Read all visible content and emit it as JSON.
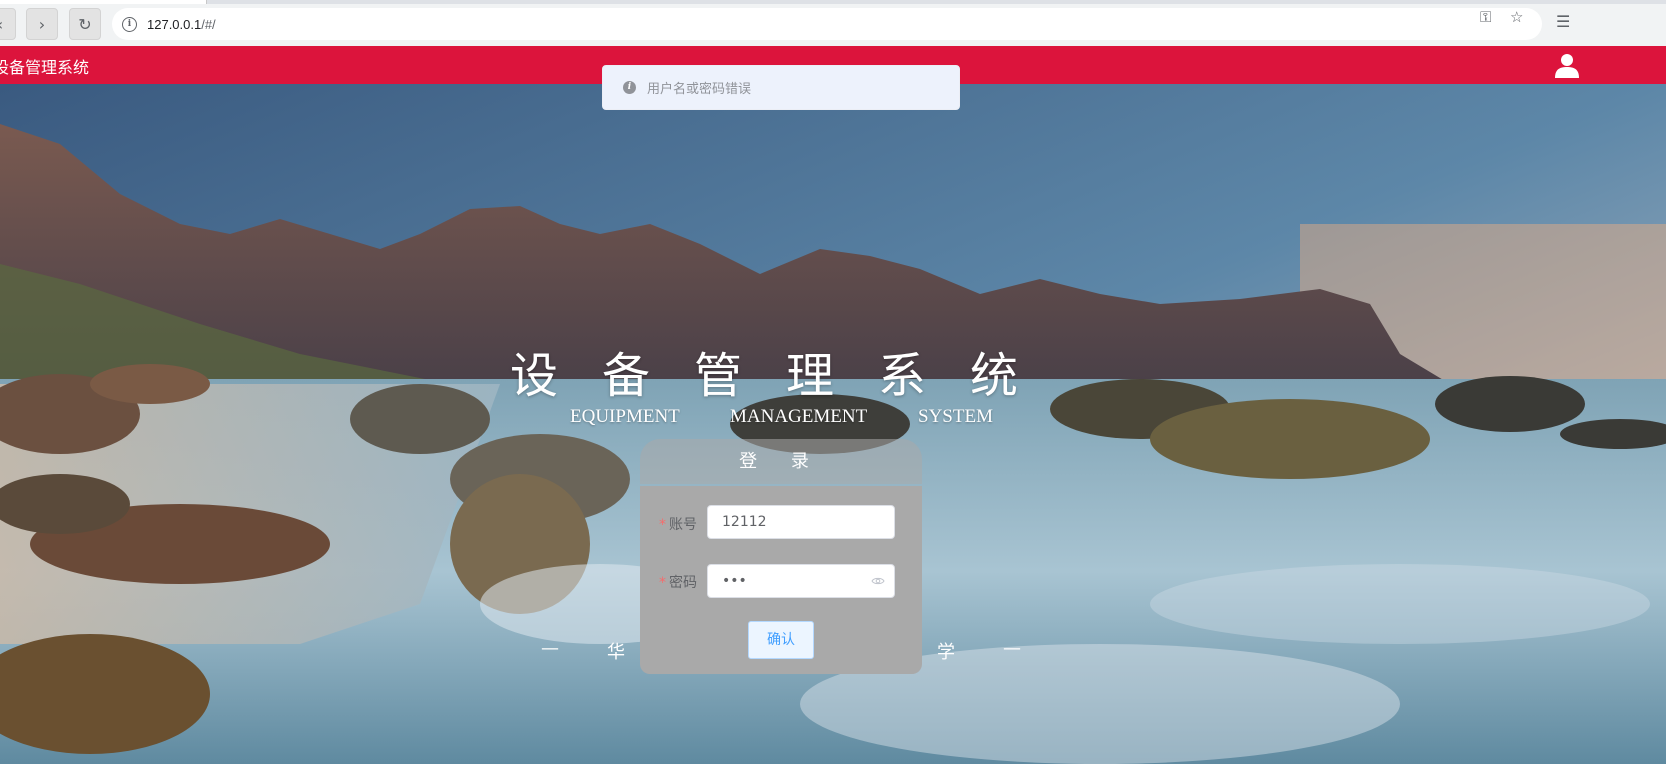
{
  "browser": {
    "url_host": "127.0.0.1",
    "url_path": "/#/"
  },
  "header": {
    "title": "设备管理系统"
  },
  "message": {
    "text": "用户名或密码错误",
    "type": "info"
  },
  "hero": {
    "title": "设备管理系统",
    "subtitle_words": [
      "EQUIPMENT",
      "MANAGEMENT",
      "SYSTEM"
    ],
    "footer_visible": [
      "—",
      "华",
      "学",
      "—"
    ]
  },
  "login": {
    "heading": "登 录",
    "account_label": "账号",
    "account_value": "12112",
    "password_label": "密码",
    "password_value": "•••",
    "required_mark": "*",
    "confirm_label": "确认"
  },
  "colors": {
    "header_bg": "#dc143c",
    "toast_bg": "#edf2fc",
    "button_text": "#409eff"
  }
}
